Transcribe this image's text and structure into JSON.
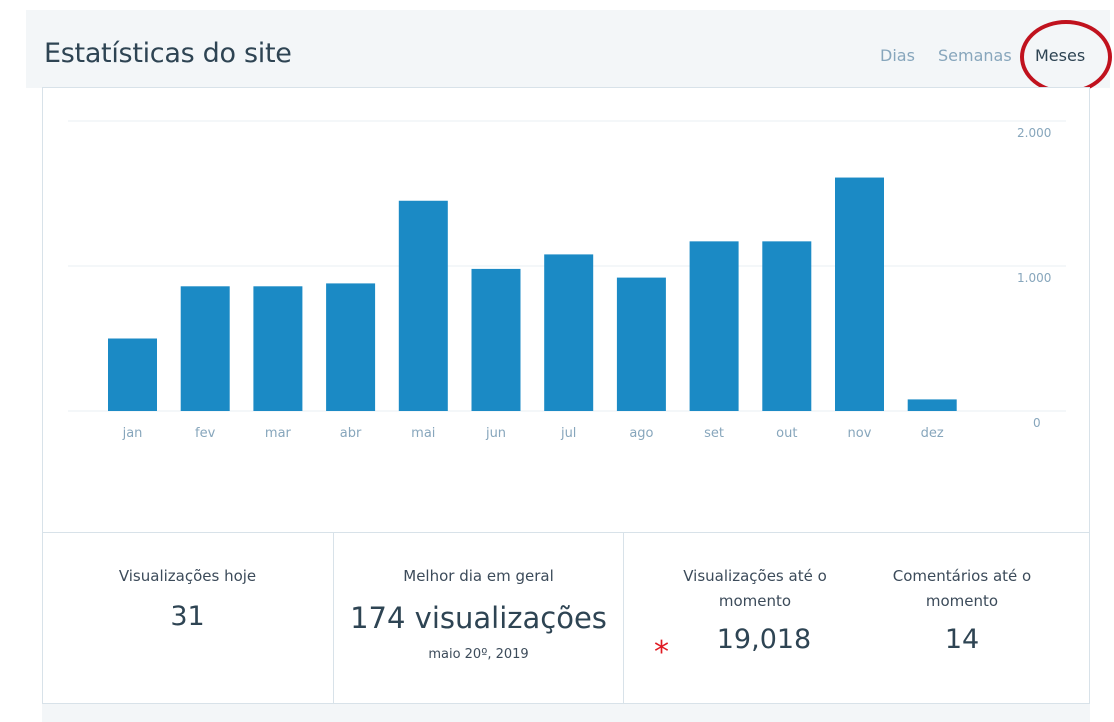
{
  "header": {
    "title": "Estatísticas do site",
    "tabs": [
      {
        "label": "Dias",
        "active": false
      },
      {
        "label": "Semanas",
        "active": false
      },
      {
        "label": "Meses",
        "active": true
      }
    ]
  },
  "chart_data": {
    "type": "bar",
    "categories": [
      "jan",
      "fev",
      "mar",
      "abr",
      "mai",
      "jun",
      "jul",
      "ago",
      "set",
      "out",
      "nov",
      "dez"
    ],
    "values": [
      500,
      860,
      860,
      880,
      1450,
      980,
      1080,
      920,
      1170,
      1170,
      1610,
      80
    ],
    "y_ticks": [
      "0",
      "1.000",
      "2.000"
    ],
    "ylim": [
      0,
      2000
    ],
    "bar_color": "#1b8ac5",
    "grid": true
  },
  "stats": {
    "views_today": {
      "label": "Visualizações hoje",
      "value": "31"
    },
    "best_day": {
      "label": "Melhor dia em geral",
      "value": "174 visualizações",
      "date": "maio 20º, 2019"
    },
    "total_views": {
      "label_line1": "Visualizações até o",
      "label_line2": "momento",
      "value": "19,018"
    },
    "total_comments": {
      "label_line1": "Comentários até o",
      "label_line2": "momento",
      "value": "14"
    }
  },
  "annotation": {
    "asterisk": "*",
    "color": "#e01a22"
  }
}
